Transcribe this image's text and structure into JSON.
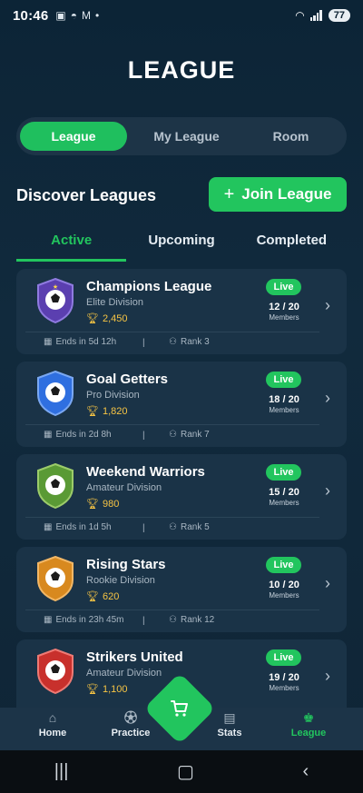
{
  "status_bar": {
    "time": "10:46",
    "battery": "77"
  },
  "page_title": "LEAGUE",
  "segments": [
    {
      "label": "League",
      "active": true
    },
    {
      "label": "My League",
      "active": false
    },
    {
      "label": "Room",
      "active": false
    }
  ],
  "discover_title": "Discover Leagues",
  "join_button": {
    "label": "Join League"
  },
  "tabs": [
    {
      "label": "Active",
      "active": true
    },
    {
      "label": "Upcoming",
      "active": false
    },
    {
      "label": "Completed",
      "active": false
    }
  ],
  "leagues": [
    {
      "name": "Champions League",
      "division": "Elite Division",
      "points": "2,450",
      "status": "Live",
      "members": "12 / 20",
      "members_label": "Members",
      "ends": "Ends in 5d 12h",
      "rank": "Rank 3",
      "badge_color": "#5b3fb0"
    },
    {
      "name": "Goal Getters",
      "division": "Pro Division",
      "points": "1,820",
      "status": "Live",
      "members": "18 / 20",
      "members_label": "Members",
      "ends": "Ends in 2d 8h",
      "rank": "Rank 7",
      "badge_color": "#2f6fe0"
    },
    {
      "name": "Weekend Warriors",
      "division": "Amateur Division",
      "points": "980",
      "status": "Live",
      "members": "15 / 20",
      "members_label": "Members",
      "ends": "Ends in 1d 5h",
      "rank": "Rank 5",
      "badge_color": "#5a9a35"
    },
    {
      "name": "Rising Stars",
      "division": "Rookie Division",
      "points": "620",
      "status": "Live",
      "members": "10 / 20",
      "members_label": "Members",
      "ends": "Ends in 23h 45m",
      "rank": "Rank 12",
      "badge_color": "#d8891f"
    },
    {
      "name": "Strikers United",
      "division": "Amateur Division",
      "points": "1,100",
      "status": "Live",
      "members": "19 / 20",
      "members_label": "Members",
      "ends": "",
      "rank": "",
      "badge_color": "#c8302c"
    }
  ],
  "bottom_nav": [
    {
      "label": "Home",
      "icon": "home-icon"
    },
    {
      "label": "Practice",
      "icon": "player-icon"
    },
    {
      "label": "Stats",
      "icon": "stats-icon"
    },
    {
      "label": "League",
      "icon": "league-icon",
      "active": true
    }
  ],
  "colors": {
    "accent": "#22c55e",
    "background": "#0f2536",
    "card": "#1a3347",
    "gold": "#f6c444"
  }
}
